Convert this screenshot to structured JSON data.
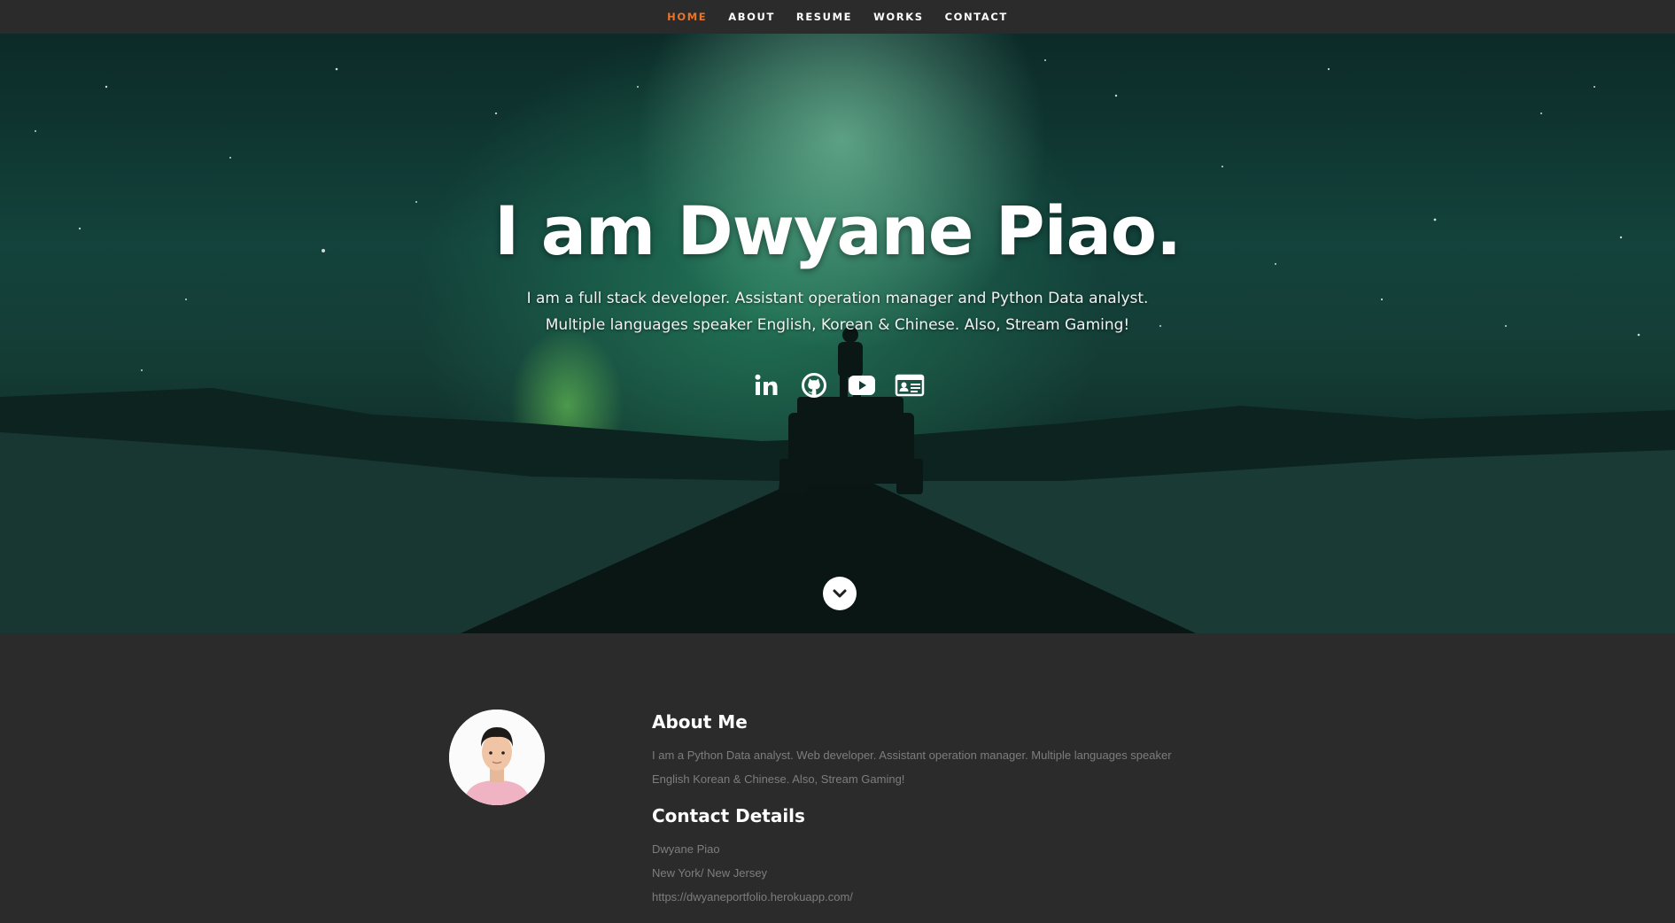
{
  "nav": {
    "items": [
      {
        "label": "HOME",
        "active": true
      },
      {
        "label": "ABOUT",
        "active": false
      },
      {
        "label": "RESUME",
        "active": false
      },
      {
        "label": "WORKS",
        "active": false
      },
      {
        "label": "CONTACT",
        "active": false
      }
    ],
    "active_color": "#e8742b"
  },
  "hero": {
    "title": "I am Dwyane Piao.",
    "subtitle_line1": "I am a full stack developer. Assistant operation manager and Python Data analyst.",
    "subtitle_line2": "Multiple languages speaker English, Korean & Chinese. Also, Stream Gaming!",
    "socials": [
      "linkedin-icon",
      "github-icon",
      "youtube-icon",
      "contact-card-icon"
    ],
    "scroll_icon": "chevron-down-icon"
  },
  "about": {
    "heading": "About Me",
    "body": "I am a Python Data analyst. Web developer. Assistant operation manager. Multiple languages speaker English Korean & Chinese. Also, Stream Gaming!",
    "contact_heading": "Contact Details",
    "contact_name": "Dwyane Piao",
    "contact_location": "New York/ New Jersey",
    "contact_url": "https://dwyaneportfolio.herokuapp.com/"
  },
  "colors": {
    "background": "#2b2b2b",
    "accent": "#e8742b",
    "muted_text": "#7d7d7d"
  }
}
